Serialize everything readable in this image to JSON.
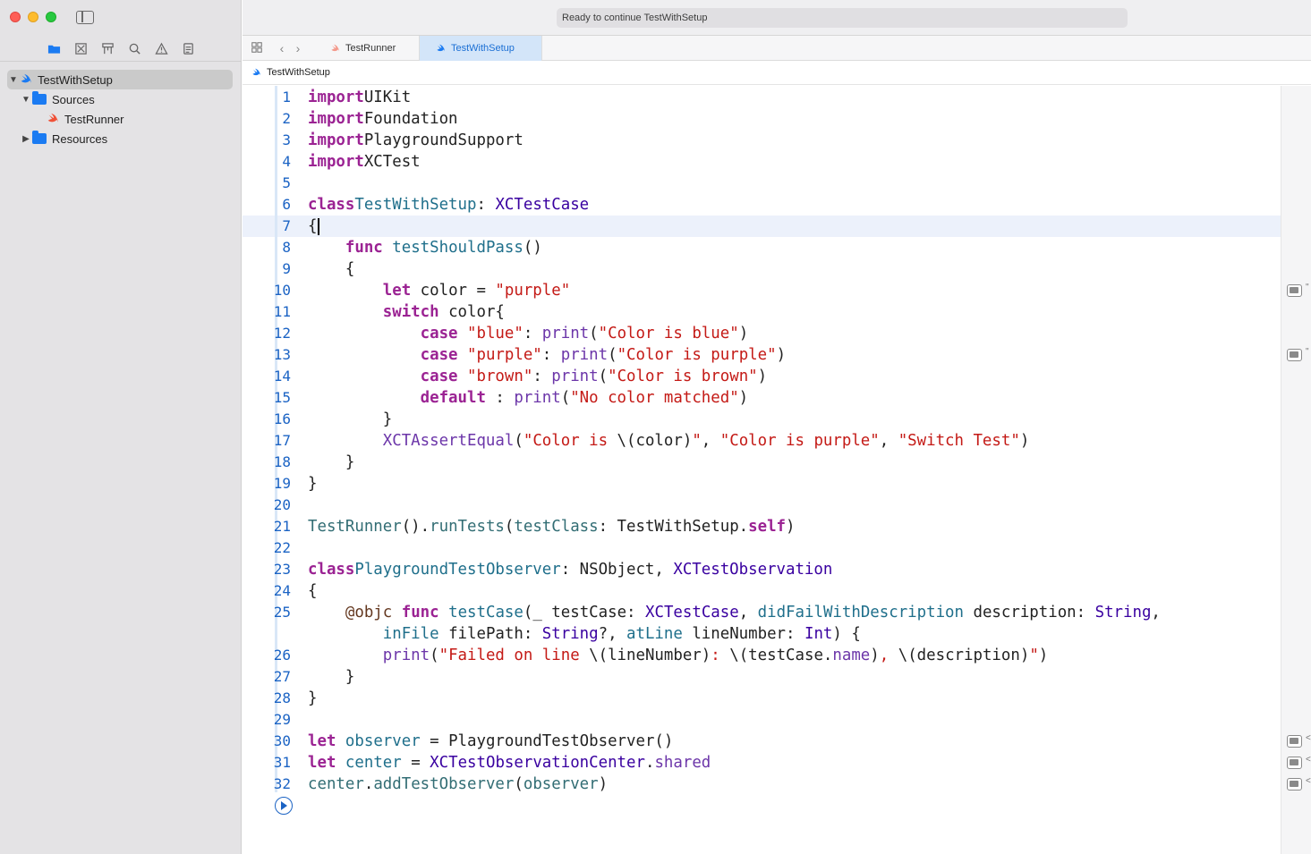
{
  "window": {
    "activity_status": "Ready to continue TestWithSetup"
  },
  "tabs": [
    {
      "label": "TestRunner",
      "active": false
    },
    {
      "label": "TestWithSetup",
      "active": true
    }
  ],
  "breadcrumb": {
    "label": "TestWithSetup"
  },
  "navigator": {
    "icons": [
      "folder-icon",
      "source-control-icon",
      "symbol-icon",
      "find-icon",
      "issue-icon",
      "report-icon"
    ],
    "tree": [
      {
        "label": "TestWithSetup",
        "icon": "swift-icon",
        "expanded": true,
        "selected": true
      },
      {
        "label": "Sources",
        "icon": "folder-icon",
        "expanded": true
      },
      {
        "label": "TestRunner",
        "icon": "swift-icon"
      },
      {
        "label": "Resources",
        "icon": "folder-icon",
        "expanded": false
      }
    ]
  },
  "editor": {
    "current_line": 7,
    "lines": [
      {
        "n": "1"
      },
      {
        "n": "2"
      },
      {
        "n": "3"
      },
      {
        "n": "4"
      },
      {
        "n": "5"
      },
      {
        "n": "6"
      },
      {
        "n": "7"
      },
      {
        "n": "8"
      },
      {
        "n": "9"
      },
      {
        "n": "10"
      },
      {
        "n": "11"
      },
      {
        "n": "12"
      },
      {
        "n": "13"
      },
      {
        "n": "14"
      },
      {
        "n": "15"
      },
      {
        "n": "16"
      },
      {
        "n": "17"
      },
      {
        "n": "18"
      },
      {
        "n": "19"
      },
      {
        "n": "20"
      },
      {
        "n": "21"
      },
      {
        "n": "22"
      },
      {
        "n": "23"
      },
      {
        "n": "24"
      },
      {
        "n": "25"
      },
      {
        "n": ""
      },
      {
        "n": "26"
      },
      {
        "n": "27"
      },
      {
        "n": "28"
      },
      {
        "n": "29"
      },
      {
        "n": "30"
      },
      {
        "n": "31"
      },
      {
        "n": "32"
      }
    ],
    "code": [
      [
        [
          "kw",
          "import"
        ],
        [
          "",
          "UIKit"
        ]
      ],
      [
        [
          "kw",
          "import"
        ],
        [
          "",
          "Foundation"
        ]
      ],
      [
        [
          "kw",
          "import"
        ],
        [
          "",
          "PlaygroundSupport"
        ]
      ],
      [
        [
          "kw",
          "import"
        ],
        [
          "",
          "XCTest"
        ]
      ],
      [],
      [
        [
          "kw",
          "class"
        ],
        [
          "tn",
          "TestWithSetup"
        ],
        [
          "",
          ": "
        ],
        [
          "ty",
          "XCTestCase"
        ]
      ],
      [
        [
          "",
          "{"
        ]
      ],
      [
        [
          "",
          "    "
        ],
        [
          "kw",
          "func"
        ],
        [
          "",
          ""
        ],
        [
          "tn",
          "testShouldPass"
        ],
        [
          "",
          "()"
        ]
      ],
      [
        [
          "",
          "    {"
        ]
      ],
      [
        [
          "",
          "        "
        ],
        [
          "kw",
          "let"
        ],
        [
          "",
          " color = "
        ],
        [
          "st",
          "\"purple\""
        ]
      ],
      [
        [
          "",
          "        "
        ],
        [
          "kw",
          "switch"
        ],
        [
          "",
          " color{"
        ]
      ],
      [
        [
          "",
          "            "
        ],
        [
          "kw",
          "case"
        ],
        [
          "",
          ""
        ],
        [
          "st",
          "\"blue\""
        ],
        [
          "",
          ": "
        ],
        [
          "mb",
          "print"
        ],
        [
          "",
          "("
        ],
        [
          "st",
          "\"Color is blue\""
        ],
        [
          "",
          ")"
        ]
      ],
      [
        [
          "",
          "            "
        ],
        [
          "kw",
          "case"
        ],
        [
          "",
          ""
        ],
        [
          "st",
          "\"purple\""
        ],
        [
          "",
          ": "
        ],
        [
          "mb",
          "print"
        ],
        [
          "",
          "("
        ],
        [
          "st",
          "\"Color is purple\""
        ],
        [
          "",
          ")"
        ]
      ],
      [
        [
          "",
          "            "
        ],
        [
          "kw",
          "case"
        ],
        [
          "",
          ""
        ],
        [
          "st",
          "\"brown\""
        ],
        [
          "",
          ": "
        ],
        [
          "mb",
          "print"
        ],
        [
          "",
          "("
        ],
        [
          "st",
          "\"Color is brown\""
        ],
        [
          "",
          ")"
        ]
      ],
      [
        [
          "",
          "            "
        ],
        [
          "kw",
          "default"
        ],
        [
          "",
          " : "
        ],
        [
          "mb",
          "print"
        ],
        [
          "",
          "("
        ],
        [
          "st",
          "\"No color matched\""
        ],
        [
          "",
          ")"
        ]
      ],
      [
        [
          "",
          "        }"
        ]
      ],
      [
        [
          "",
          "        "
        ],
        [
          "mb",
          "XCTAssertEqual"
        ],
        [
          "",
          "("
        ],
        [
          "st",
          "\"Color is "
        ],
        [
          "",
          "\\(color)"
        ],
        [
          "st",
          "\""
        ],
        [
          "",
          ", "
        ],
        [
          "st",
          "\"Color is purple\""
        ],
        [
          "",
          ", "
        ],
        [
          "st",
          "\"Switch Test\""
        ],
        [
          "",
          ")"
        ]
      ],
      [
        [
          "",
          "    }"
        ]
      ],
      [
        [
          "",
          "}"
        ]
      ],
      [],
      [
        [
          "fn",
          "TestRunner"
        ],
        [
          "",
          "()."
        ],
        [
          "fn",
          "runTests"
        ],
        [
          "",
          "("
        ],
        [
          "fn",
          "testClass"
        ],
        [
          "",
          ": TestWithSetup."
        ],
        [
          "kw",
          "self"
        ],
        [
          "",
          ")"
        ]
      ],
      [],
      [
        [
          "kw",
          "class"
        ],
        [
          "tn",
          "PlaygroundTestObserver"
        ],
        [
          "",
          ": NSObject, "
        ],
        [
          "ty",
          "XCTestObservation"
        ]
      ],
      [
        [
          "",
          "{"
        ]
      ],
      [
        [
          "",
          "    "
        ],
        [
          "at",
          "@objc"
        ],
        [
          "",
          ""
        ],
        [
          "kw",
          "func"
        ],
        [
          "",
          ""
        ],
        [
          "tn",
          "testCase"
        ],
        [
          "",
          "(_ testCase: "
        ],
        [
          "ty",
          "XCTestCase"
        ],
        [
          "",
          ", "
        ],
        [
          "tn",
          "didFailWithDescription"
        ],
        [
          "",
          " description: "
        ],
        [
          "ty",
          "String"
        ],
        [
          "",
          ","
        ]
      ],
      [
        [
          "",
          "        "
        ],
        [
          "tn",
          "inFile"
        ],
        [
          "",
          " filePath: "
        ],
        [
          "ty",
          "String"
        ],
        [
          "",
          "?, "
        ],
        [
          "tn",
          "atLine"
        ],
        [
          "",
          " lineNumber: "
        ],
        [
          "ty",
          "Int"
        ],
        [
          "",
          ") {"
        ]
      ],
      [
        [
          "",
          "        "
        ],
        [
          "mb",
          "print"
        ],
        [
          "",
          "("
        ],
        [
          "st",
          "\"Failed on line "
        ],
        [
          "",
          "\\(lineNumber)"
        ],
        [
          "st",
          ": "
        ],
        [
          "",
          "\\(testCase."
        ],
        [
          "mb",
          "name"
        ],
        [
          "",
          ")"
        ],
        [
          "st",
          ", "
        ],
        [
          "",
          "\\(description)"
        ],
        [
          "st",
          "\""
        ],
        [
          "",
          ")"
        ]
      ],
      [
        [
          "",
          "    }"
        ]
      ],
      [
        [
          "",
          "}"
        ]
      ],
      [],
      [
        [
          "kw",
          "let"
        ],
        [
          "",
          ""
        ],
        [
          "tn",
          "observer"
        ],
        [
          "",
          " = PlaygroundTestObserver()"
        ]
      ],
      [
        [
          "kw",
          "let"
        ],
        [
          "",
          ""
        ],
        [
          "tn",
          "center"
        ],
        [
          "",
          " = "
        ],
        [
          "ty",
          "XCTestObservationCenter"
        ],
        [
          "",
          "."
        ],
        [
          "mb",
          "shared"
        ]
      ],
      [
        [
          "fn",
          "center"
        ],
        [
          "",
          "."
        ],
        [
          "fn",
          "addTestObserver"
        ],
        [
          "",
          "("
        ],
        [
          "fn",
          "observer"
        ],
        [
          "",
          ")"
        ]
      ]
    ]
  },
  "results_sidebar": {
    "markers": [
      {
        "line": "10",
        "tail": "\""
      },
      {
        "line": "13",
        "tail": "\""
      },
      {
        "line": "30",
        "tail": "<"
      },
      {
        "line": "31",
        "tail": "<"
      },
      {
        "line": "32",
        "tail": "<"
      }
    ]
  }
}
